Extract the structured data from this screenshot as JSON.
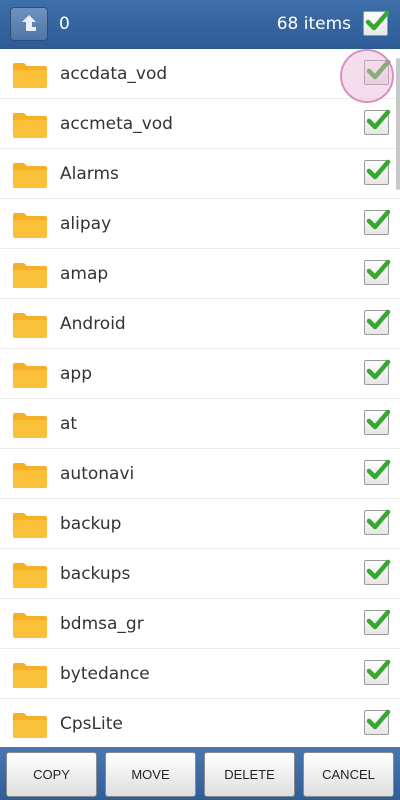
{
  "header": {
    "selected_count": "0",
    "items_label": "68 items"
  },
  "colors": {
    "header_bg": "#3564a0",
    "folder": "#f7b026",
    "check": "#35a82d"
  },
  "icons": {
    "up": "up-arrow-icon",
    "folder": "folder-icon",
    "check": "checkmark-icon"
  },
  "files": [
    {
      "name": "accdata_vod",
      "checked": true
    },
    {
      "name": "accmeta_vod",
      "checked": true
    },
    {
      "name": "Alarms",
      "checked": true
    },
    {
      "name": "alipay",
      "checked": true
    },
    {
      "name": "amap",
      "checked": true
    },
    {
      "name": "Android",
      "checked": true
    },
    {
      "name": "app",
      "checked": true
    },
    {
      "name": "at",
      "checked": true
    },
    {
      "name": "autonavi",
      "checked": true
    },
    {
      "name": "backup",
      "checked": true
    },
    {
      "name": "backups",
      "checked": true
    },
    {
      "name": "bdmsa_gr",
      "checked": true
    },
    {
      "name": "bytedance",
      "checked": true
    },
    {
      "name": "CpsLite",
      "checked": true
    }
  ],
  "actions": {
    "copy": "COPY",
    "move": "MOVE",
    "delete": "DELETE",
    "cancel": "CANCEL"
  }
}
